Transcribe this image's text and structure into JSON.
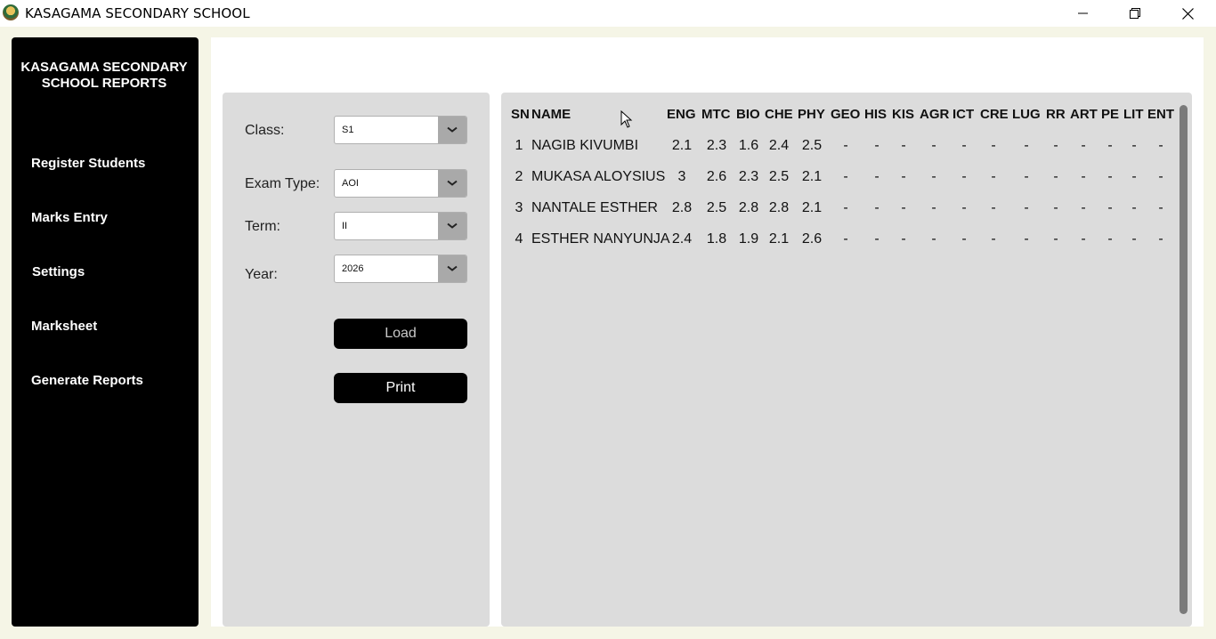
{
  "window": {
    "title": "KASAGAMA SECONDARY SCHOOL"
  },
  "sidebar": {
    "brand": "KASAGAMA SECONDARY\nSCHOOL REPORTS",
    "items": [
      {
        "label": "Register Students"
      },
      {
        "label": "Marks Entry"
      },
      {
        "label": "Settings"
      },
      {
        "label": "Marksheet"
      },
      {
        "label": "Generate Reports"
      }
    ]
  },
  "filters": {
    "class_label": "Class:",
    "class_value": "S1",
    "exam_label": "Exam Type:",
    "exam_value": "AOI",
    "term_label": "Term:",
    "term_value": "II",
    "year_label": "Year:",
    "year_value": "2026",
    "load_label": "Load",
    "print_label": "Print"
  },
  "table": {
    "headers": [
      "SN",
      "NAME",
      "ENG",
      "MTC",
      "BIO",
      "CHE",
      "PHY",
      "GEO",
      "HIS",
      "KIS",
      "AGR",
      "ICT",
      "CRE",
      "LUG",
      "RR",
      "ART",
      "PE",
      "LIT",
      "ENT"
    ],
    "rows": [
      {
        "sn": "1",
        "name": "NAGIB KIVUMBI",
        "marks": [
          "2.1",
          "2.3",
          "1.6",
          "2.4",
          "2.5",
          "-",
          "-",
          "-",
          "-",
          "-",
          "-",
          "-",
          "-",
          "-",
          "-",
          "-",
          "-"
        ]
      },
      {
        "sn": "2",
        "name": "MUKASA ALOYSIUS",
        "marks": [
          "3",
          "2.6",
          "2.3",
          "2.5",
          "2.1",
          "-",
          "-",
          "-",
          "-",
          "-",
          "-",
          "-",
          "-",
          "-",
          "-",
          "-",
          "-"
        ]
      },
      {
        "sn": "3",
        "name": "NANTALE ESTHER",
        "marks": [
          "2.8",
          "2.5",
          "2.8",
          "2.8",
          "2.1",
          "-",
          "-",
          "-",
          "-",
          "-",
          "-",
          "-",
          "-",
          "-",
          "-",
          "-",
          "-"
        ]
      },
      {
        "sn": "4",
        "name": "ESTHER NANYUNJA",
        "marks": [
          "2.4",
          "1.8",
          "1.9",
          "2.1",
          "2.6",
          "-",
          "-",
          "-",
          "-",
          "-",
          "-",
          "-",
          "-",
          "-",
          "-",
          "-",
          "-"
        ]
      }
    ]
  },
  "icons": {
    "app": "school-crest-icon",
    "minimize": "minimize-icon",
    "maximize": "restore-icon",
    "close": "close-icon",
    "dropdown": "chevron-down-icon",
    "cursor": "mouse-pointer-icon"
  },
  "colors": {
    "sidebar": "#000000",
    "panel": "#dcdcdc",
    "window_bg": "#f5f5e6"
  }
}
